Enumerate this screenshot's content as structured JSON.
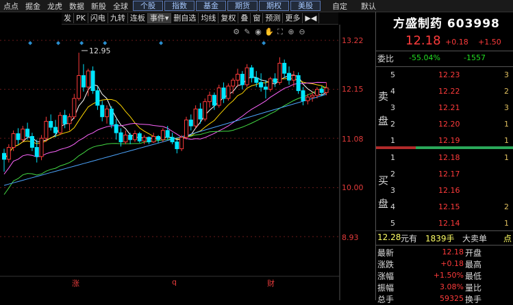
{
  "topbar": {
    "menus": [
      "点点",
      "掘金",
      "龙虎",
      "数据",
      "新股",
      "全球"
    ],
    "tabs": [
      "个股",
      "指数",
      "基金",
      "期货",
      "期权",
      "美股"
    ],
    "extra": [
      "自定",
      "默认"
    ]
  },
  "toolbar": {
    "items": [
      "发",
      "PK",
      "闪电",
      "九转",
      "连板",
      "事件▾",
      "删自选",
      "均线",
      "复权",
      "叠",
      "窗",
      "预测",
      "更多",
      "▶◀"
    ]
  },
  "chart_icons": [
    "settings-icon",
    "pen-icon",
    "eye-icon",
    "hand-icon",
    "fullscreen-icon",
    "zoom-in-icon",
    "zoom-out-icon"
  ],
  "axis": {
    "y_labels": [
      "13.22",
      "12.15",
      "11.08",
      "10.00",
      "8.93"
    ],
    "high_label": "12.95",
    "events": [
      "涨",
      "q",
      "财"
    ]
  },
  "colors": {
    "up": "#ff3b3b",
    "down": "#00e5ff",
    "ma5": "#ffffff",
    "ma10": "#ffd700",
    "ma20": "#ff66ff",
    "ma30": "#44dd44",
    "ma60": "#4da6ff",
    "event": "#2a8fd0"
  },
  "chart_data": {
    "type": "candlestick",
    "y_range": [
      8.93,
      13.22
    ],
    "candles": [
      [
        10.75,
        10.85,
        10.35,
        10.62
      ],
      [
        10.62,
        10.95,
        10.55,
        10.88
      ],
      [
        10.88,
        11.25,
        10.8,
        11.18
      ],
      [
        11.18,
        11.3,
        10.95,
        11.05
      ],
      [
        11.05,
        11.35,
        11.0,
        11.28
      ],
      [
        11.28,
        11.42,
        11.05,
        11.12
      ],
      [
        11.12,
        11.2,
        10.8,
        10.88
      ],
      [
        10.88,
        11.05,
        10.55,
        10.68
      ],
      [
        10.68,
        11.15,
        10.6,
        11.08
      ],
      [
        11.08,
        11.55,
        11.0,
        11.45
      ],
      [
        11.45,
        11.6,
        11.25,
        11.32
      ],
      [
        11.32,
        11.48,
        11.1,
        11.2
      ],
      [
        11.2,
        11.65,
        11.15,
        11.58
      ],
      [
        11.58,
        11.7,
        11.3,
        11.4
      ],
      [
        11.4,
        11.62,
        11.25,
        11.55
      ],
      [
        11.55,
        12.05,
        11.5,
        11.95
      ],
      [
        11.95,
        12.95,
        11.9,
        12.45
      ],
      [
        12.45,
        12.7,
        12.1,
        12.2
      ],
      [
        12.2,
        12.6,
        12.0,
        12.55
      ],
      [
        12.55,
        12.65,
        12.05,
        12.12
      ],
      [
        12.12,
        12.2,
        11.7,
        11.8
      ],
      [
        11.8,
        11.9,
        11.45,
        11.55
      ],
      [
        11.55,
        11.8,
        11.4,
        11.72
      ],
      [
        11.72,
        11.78,
        11.3,
        11.38
      ],
      [
        11.38,
        11.5,
        11.05,
        11.2
      ],
      [
        11.2,
        11.3,
        10.9,
        11.0
      ],
      [
        11.0,
        11.25,
        10.95,
        11.15
      ],
      [
        11.15,
        11.2,
        10.95,
        11.05
      ],
      [
        11.05,
        11.25,
        11.0,
        11.18
      ],
      [
        11.18,
        11.22,
        10.98,
        11.02
      ],
      [
        11.02,
        11.15,
        10.95,
        11.1
      ],
      [
        11.1,
        11.12,
        10.95,
        11.0
      ],
      [
        11.0,
        11.2,
        10.98,
        11.12
      ],
      [
        11.12,
        11.15,
        10.98,
        11.05
      ],
      [
        11.05,
        11.3,
        11.0,
        11.25
      ],
      [
        11.25,
        11.35,
        11.05,
        11.1
      ],
      [
        11.1,
        11.2,
        10.95,
        11.0
      ],
      [
        11.0,
        11.05,
        10.75,
        10.85
      ],
      [
        10.85,
        11.15,
        10.8,
        11.1
      ],
      [
        11.1,
        11.55,
        11.05,
        11.48
      ],
      [
        11.48,
        11.6,
        11.25,
        11.35
      ],
      [
        11.35,
        11.8,
        11.3,
        11.72
      ],
      [
        11.72,
        11.85,
        11.4,
        11.5
      ],
      [
        11.5,
        11.95,
        11.45,
        11.88
      ],
      [
        11.88,
        12.1,
        11.75,
        12.02
      ],
      [
        12.02,
        12.08,
        11.7,
        11.8
      ],
      [
        11.8,
        12.25,
        11.75,
        12.18
      ],
      [
        12.18,
        12.3,
        11.85,
        11.95
      ],
      [
        11.95,
        12.28,
        11.9,
        12.22
      ],
      [
        12.22,
        12.4,
        12.05,
        12.35
      ],
      [
        12.35,
        12.6,
        12.2,
        12.48
      ],
      [
        12.48,
        12.55,
        12.15,
        12.25
      ],
      [
        12.25,
        12.7,
        12.2,
        12.62
      ],
      [
        12.62,
        12.68,
        12.3,
        12.4
      ],
      [
        12.4,
        12.55,
        12.2,
        12.3
      ],
      [
        12.3,
        12.5,
        12.1,
        12.2
      ],
      [
        12.2,
        12.35,
        11.95,
        12.15
      ],
      [
        12.15,
        12.42,
        12.1,
        12.38
      ],
      [
        12.38,
        12.5,
        12.2,
        12.3
      ],
      [
        12.3,
        12.85,
        12.25,
        12.72
      ],
      [
        12.72,
        12.8,
        12.4,
        12.5
      ],
      [
        12.5,
        12.65,
        12.25,
        12.35
      ],
      [
        12.35,
        12.55,
        12.2,
        12.45
      ],
      [
        12.45,
        12.52,
        12.05,
        12.12
      ],
      [
        12.12,
        12.2,
        11.8,
        11.9
      ],
      [
        11.9,
        12.05,
        11.82,
        11.98
      ],
      [
        11.98,
        12.1,
        11.88,
        12.02
      ],
      [
        12.02,
        12.2,
        11.95,
        12.15
      ],
      [
        12.15,
        12.22,
        12.0,
        12.08
      ],
      [
        12.08,
        12.3,
        12.02,
        12.18
      ]
    ],
    "ma_series": [
      "ma5",
      "ma10",
      "ma20",
      "ma30",
      "ma60"
    ],
    "event_markers": [
      5,
      11,
      16,
      21,
      33,
      55
    ]
  },
  "panel": {
    "title": "方盛制药 603998",
    "price": "12.18",
    "change": "+0.18",
    "change_pct": "+1.50",
    "weibi_label": "委比",
    "weibi_pct": "-55.04%",
    "weibi_val": "-1557",
    "sell_label": [
      "卖",
      "盘"
    ],
    "buy_label": [
      "买",
      "盘"
    ],
    "sell": [
      {
        "lv": "5",
        "pr": "12.23",
        "vol": "3"
      },
      {
        "lv": "4",
        "pr": "12.22",
        "vol": "2"
      },
      {
        "lv": "3",
        "pr": "12.21",
        "vol": "3"
      },
      {
        "lv": "2",
        "pr": "12.20",
        "vol": "1"
      },
      {
        "lv": "1",
        "pr": "12.19",
        "vol": "1"
      }
    ],
    "buy": [
      {
        "lv": "1",
        "pr": "12.18",
        "vol": "1"
      },
      {
        "lv": "2",
        "pr": "12.17",
        "vol": ""
      },
      {
        "lv": "3",
        "pr": "12.16",
        "vol": ""
      },
      {
        "lv": "4",
        "pr": "12.15",
        "vol": "2"
      },
      {
        "lv": "5",
        "pr": "12.14",
        "vol": "1"
      }
    ],
    "tick": {
      "price": "12.28",
      "unit": "元有",
      "vol": "1839手",
      "label": "大卖单",
      "extra": "点"
    },
    "stats": [
      {
        "k": "最新",
        "v": "12.18",
        "k2": "开盘"
      },
      {
        "k": "涨跌",
        "v": "+0.18",
        "k2": "最高"
      },
      {
        "k": "涨幅",
        "v": "+1.50%",
        "k2": "最低"
      },
      {
        "k": "振幅",
        "v": "3.08%",
        "k2": "量比"
      }
    ],
    "stats_cut": {
      "k": "总手",
      "v": "59325",
      "k2": "换手"
    }
  }
}
